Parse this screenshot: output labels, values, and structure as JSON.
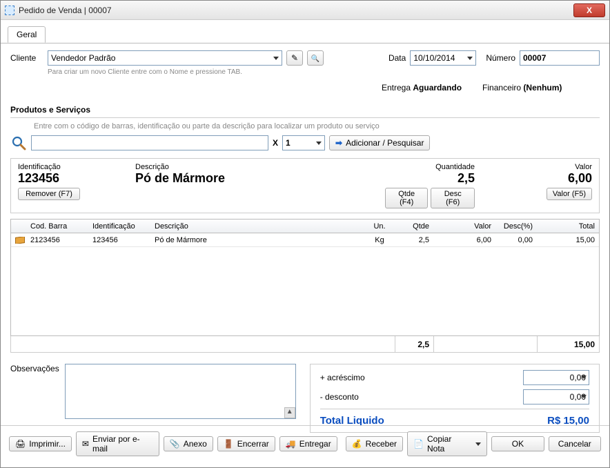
{
  "window": {
    "title": "Pedido de Venda | 00007"
  },
  "tabs": {
    "general": "Geral"
  },
  "client": {
    "label": "Cliente",
    "value": "Vendedor Padrão",
    "hint": "Para criar um novo Cliente entre com o Nome e pressione TAB."
  },
  "date": {
    "label": "Data",
    "value": "10/10/2014"
  },
  "number": {
    "label": "Número",
    "value": "00007"
  },
  "delivery": {
    "label": "Entrega",
    "value": "Aguardando"
  },
  "financial": {
    "label": "Financeiro",
    "value": "(Nenhum)"
  },
  "products": {
    "section_title": "Produtos e Serviços",
    "search_hint": "Entre com o código de barras, identificação ou parte da descrição para localizar um produto ou serviço",
    "qty_prefix": "X",
    "qty_value": "1",
    "add_button": "Adicionar / Pesquisar",
    "current": {
      "id_label": "Identificação",
      "id_value": "123456",
      "desc_label": "Descrição",
      "desc_value": "Pó de Mármore",
      "qty_label": "Quantidade",
      "qty_value": "2,5",
      "valor_label": "Valor",
      "valor_value": "6,00",
      "btn_remove": "Remover (F7)",
      "btn_qtde": "Qtde (F4)",
      "btn_desc": "Desc (F6)",
      "btn_valor": "Valor (F5)"
    },
    "columns": {
      "cod": "Cod. Barra",
      "id": "Identificação",
      "desc": "Descrição",
      "un": "Un.",
      "qtde": "Qtde",
      "valor": "Valor",
      "descp": "Desc(%)",
      "total": "Total"
    },
    "rows": [
      {
        "cod": "2123456",
        "id": "123456",
        "desc": "Pó de Mármore",
        "un": "Kg",
        "qtde": "2,5",
        "valor": "6,00",
        "descp": "0,00",
        "total": "15,00"
      }
    ],
    "sum_qtde": "2,5",
    "sum_total": "15,00"
  },
  "obs": {
    "label": "Observações"
  },
  "calc": {
    "acrescimo_label": "+ acréscimo",
    "acrescimo_value": "0,00",
    "desconto_label": "- desconto",
    "desconto_value": "0,00",
    "total_label": "Total Liquido",
    "total_value": "R$ 15,00"
  },
  "buttons": {
    "imprimir": "Imprimir...",
    "email": "Enviar por e-mail",
    "anexo": "Anexo",
    "encerrar": "Encerrar",
    "entregar": "Entregar",
    "receber": "Receber",
    "copiar": "Copiar Nota",
    "ok": "OK",
    "cancelar": "Cancelar"
  }
}
